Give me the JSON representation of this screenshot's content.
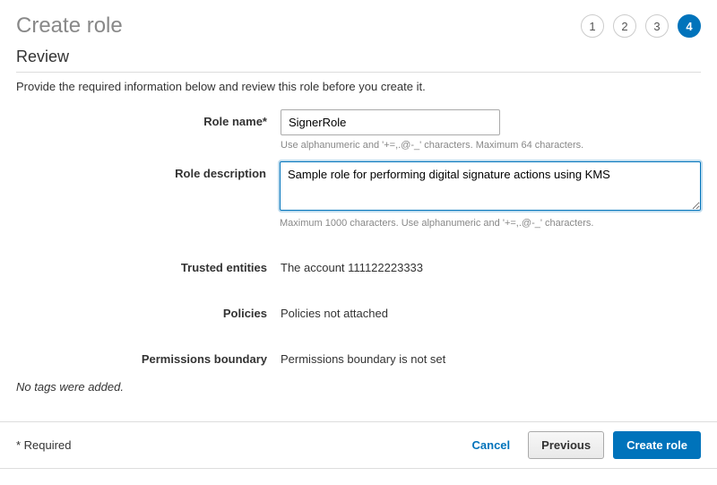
{
  "header": {
    "title": "Create role",
    "steps": [
      "1",
      "2",
      "3",
      "4"
    ],
    "activeStep": 4
  },
  "review": {
    "sectionTitle": "Review",
    "intro": "Provide the required information below and review this role before you create it.",
    "roleName": {
      "label": "Role name*",
      "value": "SignerRole",
      "hint": "Use alphanumeric and '+=,.@-_' characters. Maximum 64 characters."
    },
    "roleDescription": {
      "label": "Role description",
      "value": "Sample role for performing digital signature actions using KMS",
      "hint": "Maximum 1000 characters. Use alphanumeric and '+=,.@-_' characters."
    },
    "trustedEntities": {
      "label": "Trusted entities",
      "value": "The account 111122223333"
    },
    "policies": {
      "label": "Policies",
      "value": "Policies not attached"
    },
    "permissionsBoundary": {
      "label": "Permissions boundary",
      "value": "Permissions boundary is not set"
    },
    "noTags": "No tags were added."
  },
  "footer": {
    "requiredNote": "* Required",
    "cancel": "Cancel",
    "previous": "Previous",
    "createRole": "Create role"
  }
}
